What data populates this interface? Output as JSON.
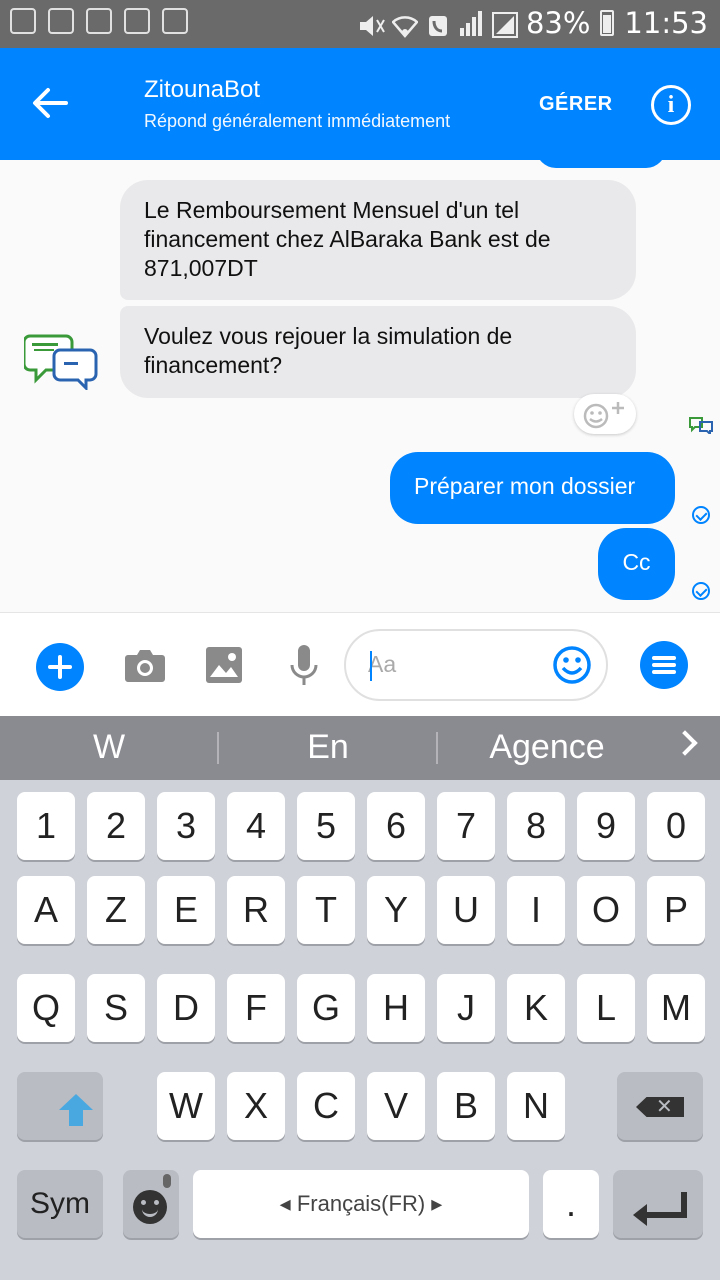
{
  "status_bar": {
    "battery": "83%",
    "time": "11:53"
  },
  "header": {
    "title": "ZitounaBot",
    "subtitle": "Répond généralement immédiatement",
    "manage_label": "GÉRER",
    "info_label": "i"
  },
  "messages": {
    "incoming": [
      "Le Remboursement Mensuel d'un tel financement chez AlBaraka Bank est de 871,007DT",
      "Voulez vous rejouer la simulation de financement?"
    ],
    "outgoing": [
      "Préparer mon dossier",
      "Cc"
    ]
  },
  "composer": {
    "placeholder": "Aa"
  },
  "keyboard": {
    "suggestions": [
      "W",
      "En",
      "Agence"
    ],
    "row_numbers": [
      "1",
      "2",
      "3",
      "4",
      "5",
      "6",
      "7",
      "8",
      "9",
      "0"
    ],
    "row1": [
      "A",
      "Z",
      "E",
      "R",
      "T",
      "Y",
      "U",
      "I",
      "O",
      "P"
    ],
    "row2": [
      "Q",
      "S",
      "D",
      "F",
      "G",
      "H",
      "J",
      "K",
      "L",
      "M"
    ],
    "row3": [
      "W",
      "X",
      "C",
      "V",
      "B",
      "N"
    ],
    "sym_label": "Sym",
    "space_label": "Français(FR)",
    "period_label": "."
  },
  "colors": {
    "accent": "#0084ff",
    "incoming_bubble": "#e9e9eb",
    "status_bar": "#6a6a6a",
    "keyboard_bg": "#cfd2d8"
  }
}
